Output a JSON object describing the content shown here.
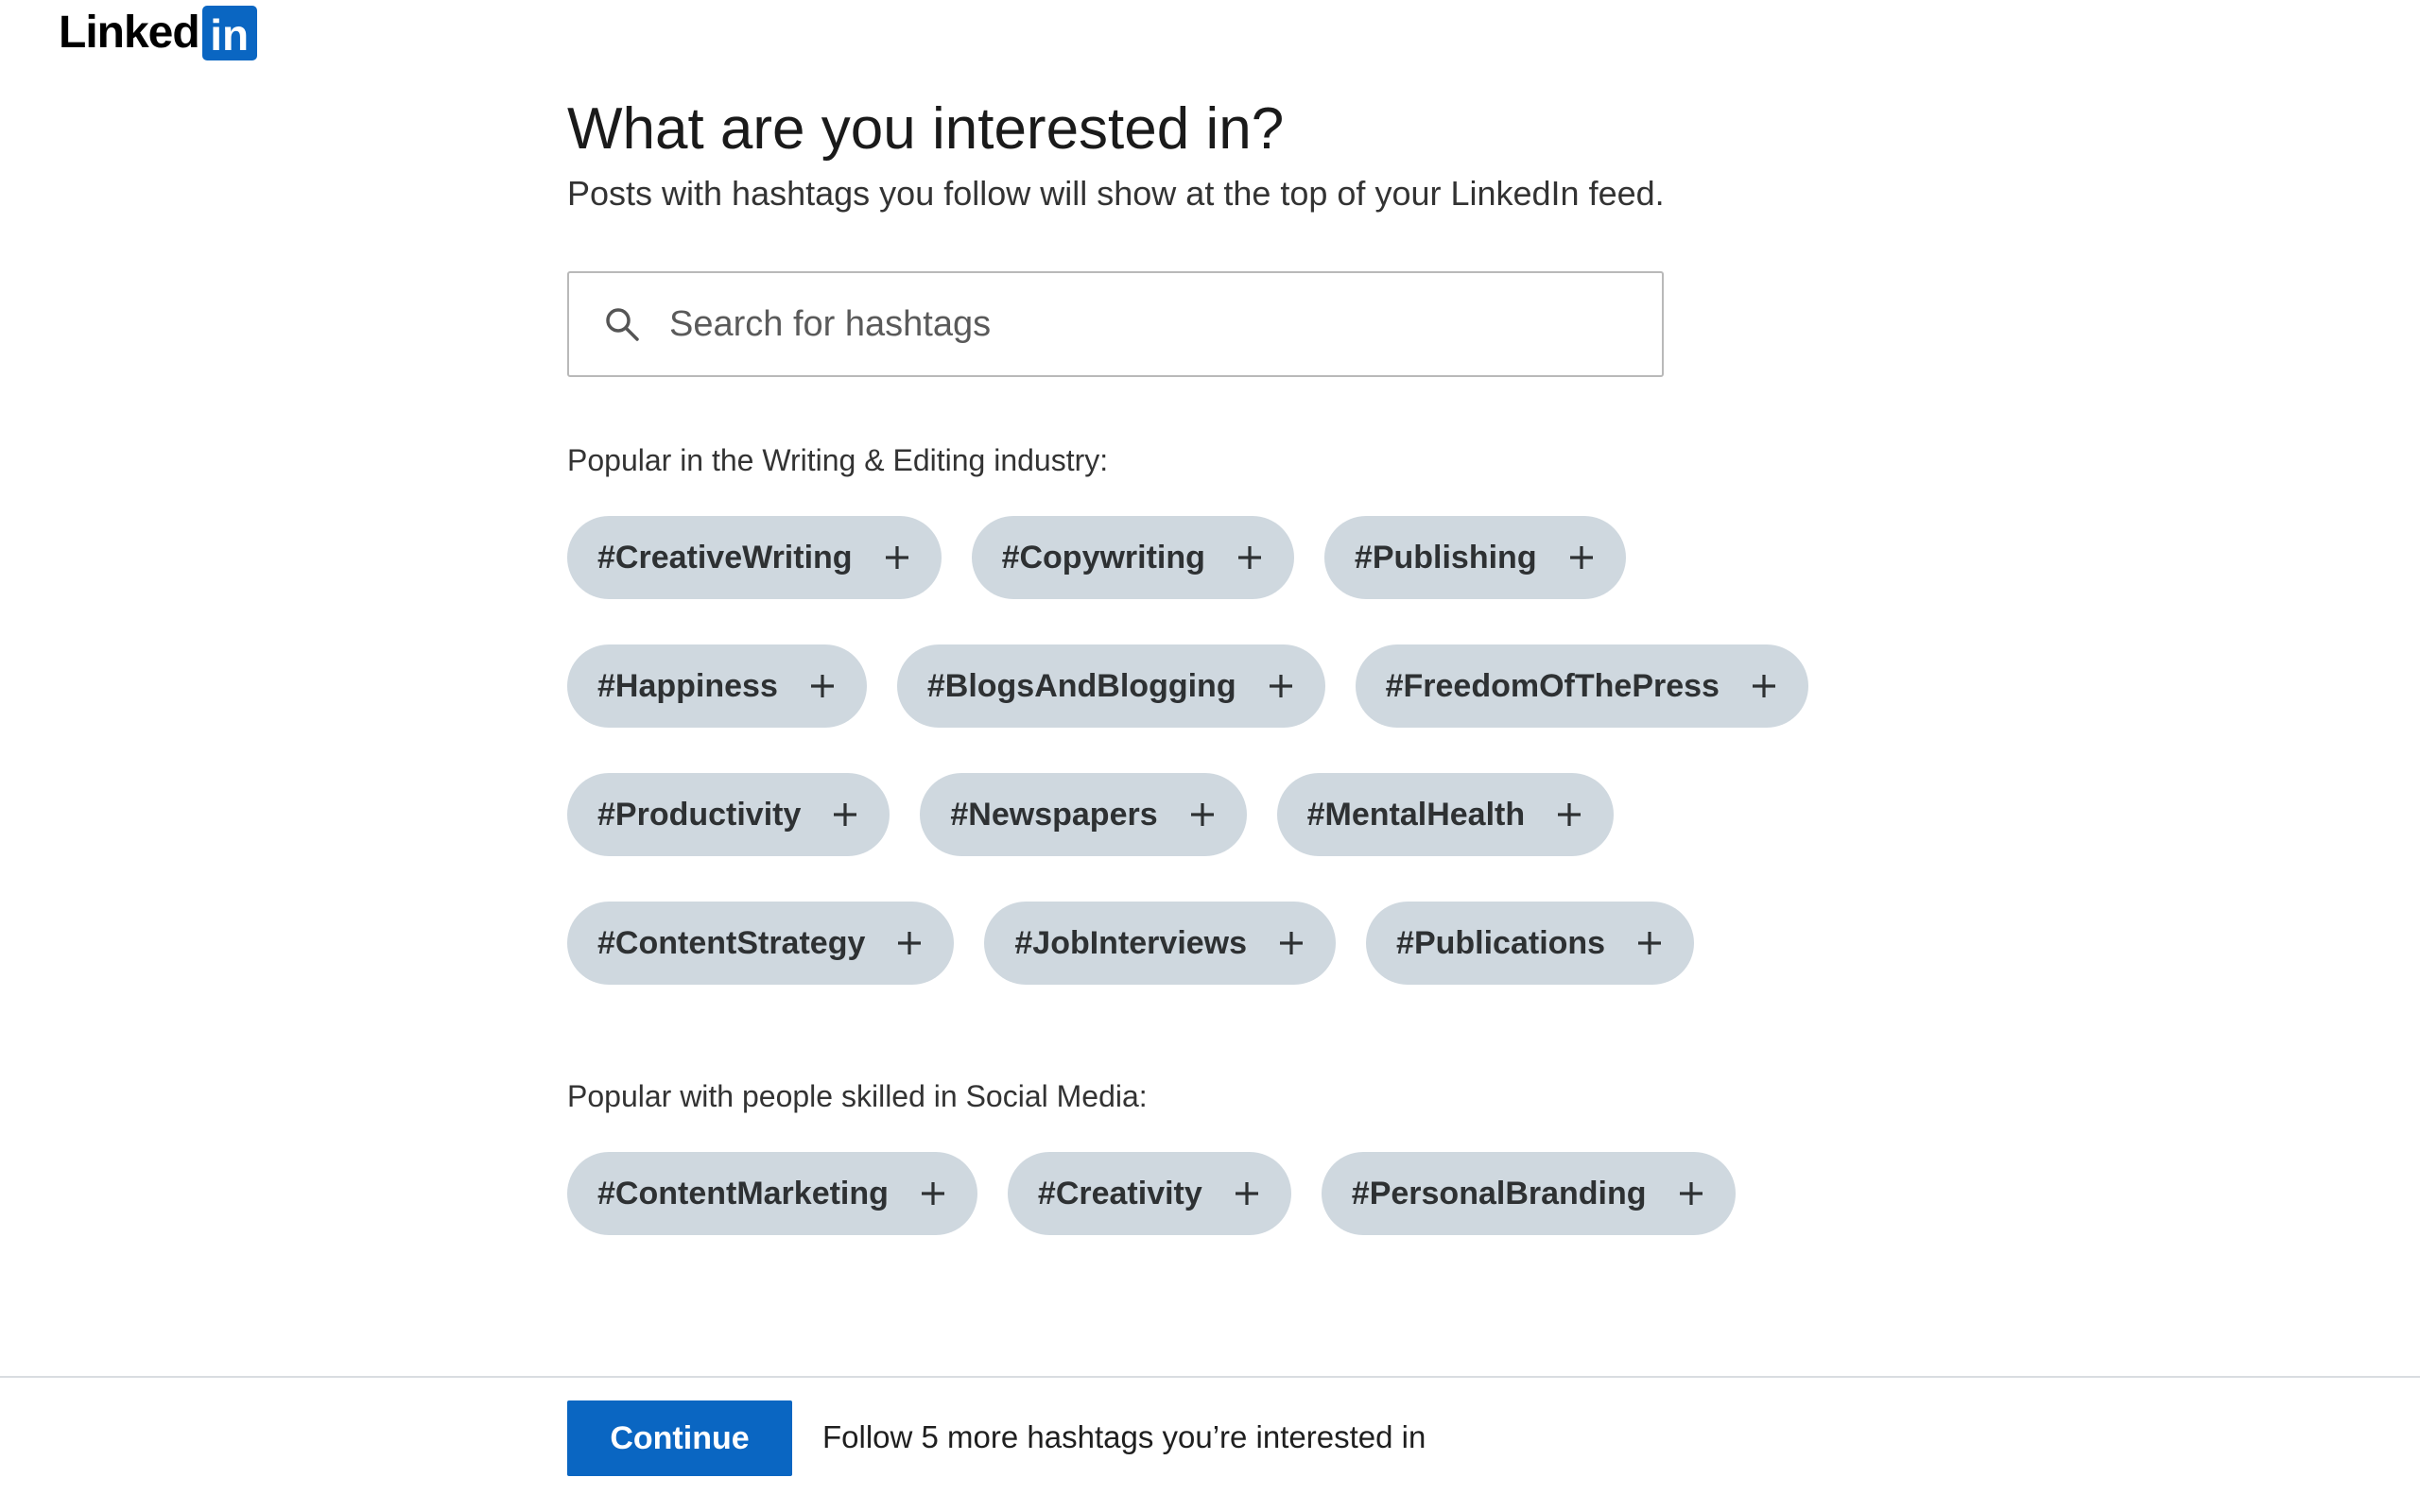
{
  "brand": {
    "logo_text": "Linked",
    "logo_box_text": "in",
    "accent_color": "#0a66c2"
  },
  "header": {
    "title": "What are you interested in?",
    "subtitle": "Posts with hashtags you follow will show at the top of your LinkedIn feed."
  },
  "search": {
    "placeholder": "Search for hashtags",
    "value": "",
    "icon": "search-icon"
  },
  "sections": [
    {
      "heading": "Popular in the Writing & Editing industry:",
      "rows": [
        [
          "#CreativeWriting",
          "#Copywriting",
          "#Publishing"
        ],
        [
          "#Happiness",
          "#BlogsAndBlogging",
          "#FreedomOfThePress"
        ],
        [
          "#Productivity",
          "#Newspapers",
          "#MentalHealth"
        ],
        [
          "#ContentStrategy",
          "#JobInterviews",
          "#Publications"
        ]
      ]
    },
    {
      "heading": "Popular with people skilled in Social Media:",
      "rows": [
        [
          "#ContentMarketing",
          "#Creativity",
          "#PersonalBranding"
        ]
      ]
    }
  ],
  "tag_style": {
    "background": "#cfd8df",
    "text_color": "#2e3133",
    "action_icon": "plus-icon"
  },
  "footer": {
    "continue_label": "Continue",
    "note": "Follow 5 more hashtags you’re interested in"
  }
}
